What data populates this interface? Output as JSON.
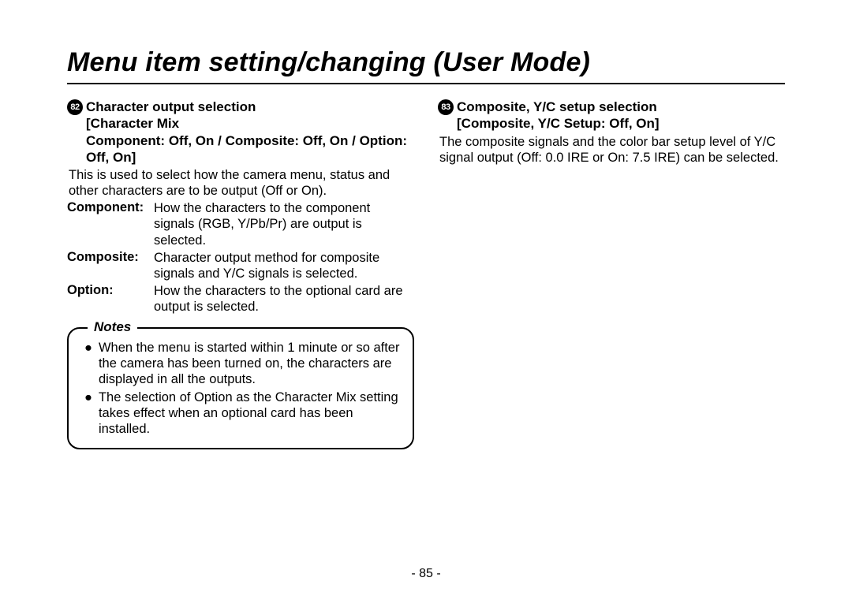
{
  "title": "Menu item setting/changing (User Mode)",
  "left": {
    "num": "82",
    "heading_line1": "Character output selection",
    "heading_line2": "[Character Mix",
    "heading_line3": "Component: Off, On / Composite: Off, On / Option: Off, On]",
    "intro": "This is used to select how the camera menu, status and other characters are to be output (Off or On).",
    "defs": [
      {
        "term": "Component:",
        "desc": "How the characters to the component signals (RGB, Y/Pb/Pr) are output is selected."
      },
      {
        "term": "Composite:",
        "desc": "Character output method for composite signals and Y/C signals is selected."
      },
      {
        "term": "Option:",
        "desc": "How the characters to the optional card are output is selected."
      }
    ],
    "notes_label": "Notes",
    "notes": [
      "When the menu is started within 1 minute or so after the camera has been turned on, the characters are displayed in all the outputs.",
      "The selection of Option as the Character Mix setting takes effect when an optional card has been installed."
    ]
  },
  "right": {
    "num": "83",
    "heading_line1": "Composite, Y/C setup selection",
    "heading_line2": "[Composite, Y/C Setup: Off, On]",
    "body": "The composite signals and the color bar setup level of Y/C signal output (Off: 0.0 IRE or On: 7.5 IRE) can be selected."
  },
  "page": "- 85 -"
}
